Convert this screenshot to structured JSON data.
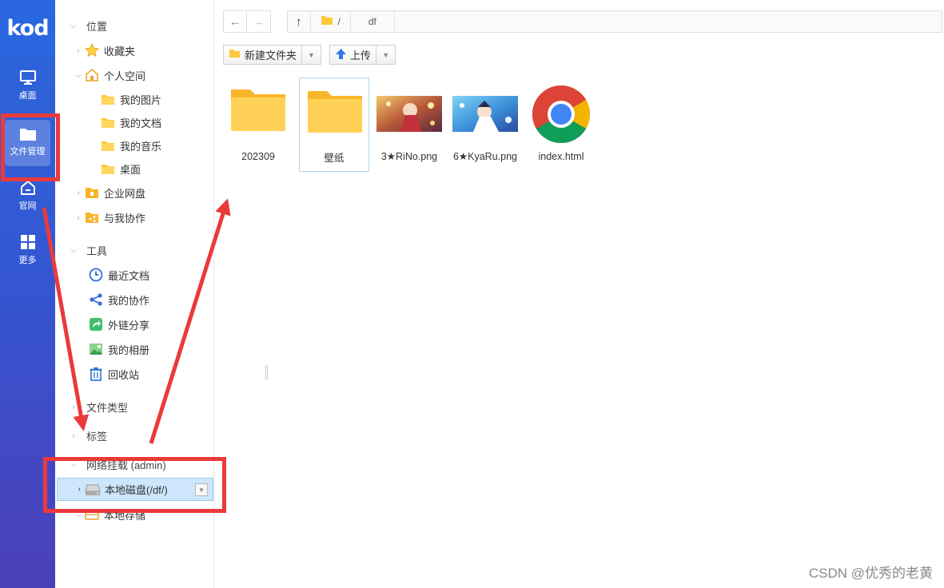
{
  "rail": {
    "logo": "kod",
    "items": [
      {
        "label": "桌面",
        "icon": "monitor-icon"
      },
      {
        "label": "文件管理",
        "icon": "folder-icon"
      },
      {
        "label": "官网",
        "icon": "home-icon"
      },
      {
        "label": "更多",
        "icon": "grid-icon"
      }
    ]
  },
  "tree": {
    "section_location": "位置",
    "favorites": "收藏夹",
    "personal_space": "个人空间",
    "my_pictures": "我的图片",
    "my_documents": "我的文档",
    "my_music": "我的音乐",
    "desktop": "桌面",
    "enterprise_disk": "企业网盘",
    "shared_with_me": "与我协作",
    "section_tools": "工具",
    "recent_docs": "最近文档",
    "my_collab": "我的协作",
    "external_share": "外链分享",
    "my_album": "我的相册",
    "recycle_bin": "回收站",
    "file_types": "文件类型",
    "tags": "标签",
    "network_mount": "网络挂载 (admin)",
    "local_disk": "本地磁盘(/df/)",
    "local_storage": "本地存储"
  },
  "address": {
    "back": "←",
    "forward": "→",
    "up": "↑",
    "root": "/",
    "current": "df"
  },
  "toolbar": {
    "new_folder": "新建文件夹",
    "upload": "上传"
  },
  "files": [
    {
      "name": "202309",
      "type": "folder"
    },
    {
      "name": "壁纸",
      "type": "folder",
      "selected": true
    },
    {
      "name": "3★RiNo.png",
      "type": "image"
    },
    {
      "name": "6★KyaRu.png",
      "type": "image"
    },
    {
      "name": "index.html",
      "type": "chrome"
    }
  ],
  "watermark": "CSDN @优秀的老黄",
  "colors": {
    "rail": "#2b66d9",
    "annotation": "#ea3a3a",
    "selected_row": "#cde6fb",
    "folder": "#ffcb3d"
  }
}
